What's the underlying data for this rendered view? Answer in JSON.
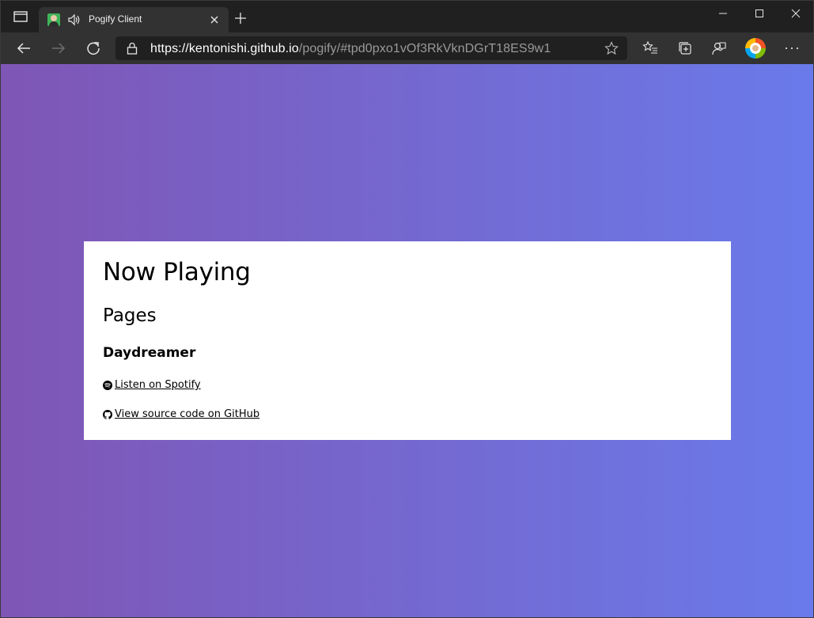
{
  "browser": {
    "tab": {
      "title": "Pogify Client"
    },
    "address": {
      "host": "https://kentonishi.github.io",
      "path": "/pogify/#tpd0pxo1vOf3RkVknDGrT18ES9w1"
    },
    "more_label": "···"
  },
  "page": {
    "heading": "Now Playing",
    "artist": "Pages",
    "track": "Daydreamer",
    "spotify_link": " Listen on Spotify",
    "github_link": " View source code on GitHub",
    "gradient_colors": [
      "#7f56b5",
      "#6a7aea"
    ]
  },
  "icons": [
    "tab-actions-icon",
    "favicon",
    "audio-icon",
    "close-icon",
    "plus-icon",
    "minimize-icon",
    "maximize-icon",
    "close-window-icon",
    "back-icon",
    "forward-icon",
    "refresh-icon",
    "lock-icon",
    "star-icon",
    "favorites-icon",
    "collections-icon",
    "feedback-icon",
    "profile-avatar",
    "more-icon",
    "spotify-icon",
    "github-icon"
  ]
}
